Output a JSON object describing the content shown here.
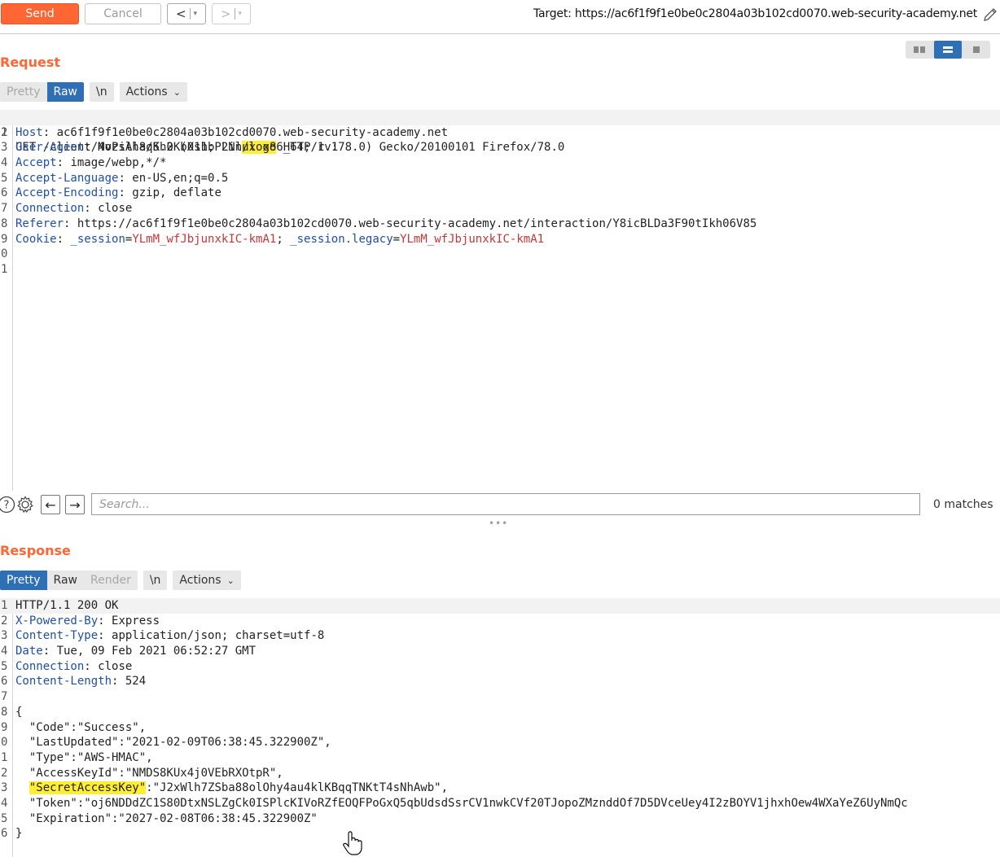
{
  "toolbar": {
    "send_label": "Send",
    "cancel_label": "Cancel",
    "back_label": "<",
    "forward_label": ">",
    "dropdown_caret": "▾",
    "target_label": "Target: ",
    "target_url": "https://ac6f1f9f1e0be0c2804a03b102cd0070.web-security-academy.net"
  },
  "request": {
    "title": "Request",
    "tabs": {
      "pretty": "Pretty",
      "raw": "Raw",
      "newline": "\\n",
      "actions": "Actions"
    },
    "line_numbers": [
      "1",
      "2",
      "3",
      "4",
      "5",
      "6",
      "7",
      "8",
      "9",
      "0",
      "1"
    ],
    "line1": {
      "method": "GET /client/4vPsAh8qKh2Kb0shbP2Nl",
      "slash": "/",
      "highlight": "logo",
      "rest": " HTTP/1.1"
    },
    "headers": [
      {
        "name": "Host",
        "value": "ac6f1f9f1e0be0c2804a03b102cd0070.web-security-academy.net"
      },
      {
        "name": "User-Agent",
        "value": "Mozilla/5.0 (X11; Linux x86_64; rv:78.0) Gecko/20100101 Firefox/78.0"
      },
      {
        "name": "Accept",
        "value": "image/webp,*/*"
      },
      {
        "name": "Accept-Language",
        "value": "en-US,en;q=0.5"
      },
      {
        "name": "Accept-Encoding",
        "value": "gzip, deflate"
      },
      {
        "name": "Connection",
        "value": "close"
      },
      {
        "name": "Referer",
        "value": "https://ac6f1f9f1e0be0c2804a03b102cd0070.web-security-academy.net/interaction/Y8icBLDa3F90tIkh06V85"
      }
    ],
    "cookie": {
      "name": "Cookie",
      "c1_name": "_session",
      "c1_value": "YLmM_wfJbjunxkIC-kmA1",
      "sep": "; ",
      "c2_name": "_session.legacy",
      "c2_value": "YLmM_wfJbjunxkIC-kmA1"
    }
  },
  "search": {
    "placeholder": "Search...",
    "matches": "0 matches"
  },
  "response": {
    "title": "Response",
    "tabs": {
      "pretty": "Pretty",
      "raw": "Raw",
      "render": "Render",
      "newline": "\\n",
      "actions": "Actions"
    },
    "line_numbers": [
      "1",
      "2",
      "3",
      "4",
      "5",
      "6",
      "7",
      "8",
      "9",
      "0",
      "1",
      "2",
      "3",
      "4",
      "5",
      "6"
    ],
    "status_line": "HTTP/1.1 200 OK",
    "headers": [
      {
        "name": "X-Powered-By",
        "value": "Express"
      },
      {
        "name": "Content-Type",
        "value": "application/json; charset=utf-8"
      },
      {
        "name": "Date",
        "value": "Tue, 09 Feb 2021 06:52:27 GMT"
      },
      {
        "name": "Connection",
        "value": "close"
      },
      {
        "name": "Content-Length",
        "value": "524"
      }
    ],
    "json_open": "{",
    "json_close": "}",
    "json_lines": [
      "  \"Code\":\"Success\",",
      "  \"LastUpdated\":\"2021-02-09T06:38:45.322900Z\",",
      "  \"Type\":\"AWS-HMAC\",",
      "  \"AccessKeyId\":\"NMDS8KUx4j0VEbRXOtpR\","
    ],
    "secret_key_name": "\"SecretAccessKey\"",
    "secret_key_value": ":\"J2xWlh7ZSba88olOhy4au4klKBqqTNKtT4sNhAwb\",",
    "json_lines_after": [
      "  \"Token\":\"oj6NDDdZC1S80DtxNSLZgCk0ISPlcKIVoRZfEOQFPoGxQ5qbUdsdSsrCV1nwkCVf20TJopoZMznddOf7D5DVceUey4I2zBOYV1jhxhOew4WXaYeZ6UyNmQc",
      "  \"Expiration\":\"2027-02-08T06:38:45.322900Z\""
    ]
  }
}
